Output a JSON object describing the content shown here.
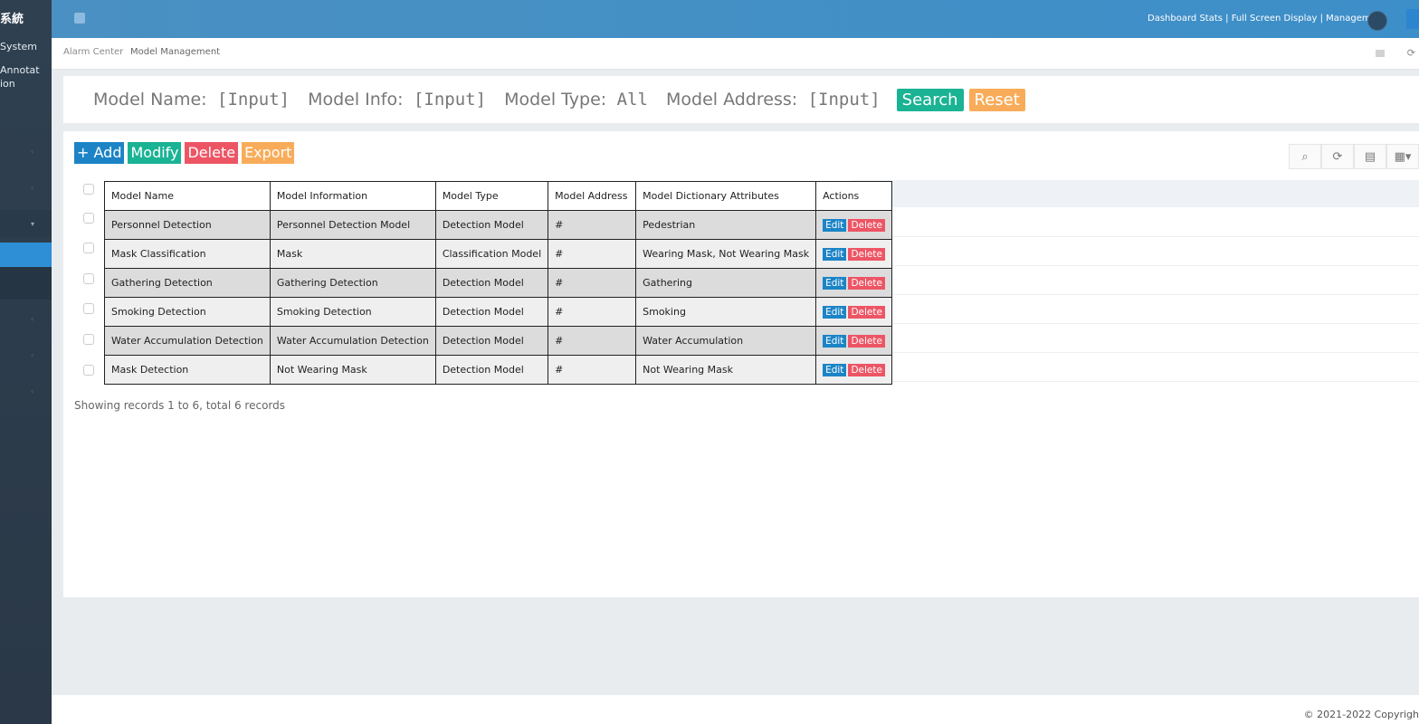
{
  "sidebar": {
    "brand": "系統",
    "items": [
      "System",
      "Annotat ion"
    ]
  },
  "topbar": {
    "links": "Dashboard Stats | Full Screen Display | Management"
  },
  "tabs": {
    "items": [
      "Alarm Center",
      "Model Management"
    ]
  },
  "search": {
    "fields": [
      {
        "label": "Model Name:",
        "value": "[Input]"
      },
      {
        "label": "Model Info:",
        "value": "[Input]"
      },
      {
        "label": "Model Type:",
        "value": "All"
      },
      {
        "label": "Model Address:",
        "value": "[Input]"
      }
    ],
    "search_label": "Search",
    "reset_label": "Reset"
  },
  "toolbar": {
    "add_label": "+ Add",
    "modify_label": "Modify",
    "delete_label": "Delete",
    "export_label": "Export"
  },
  "table": {
    "headers": [
      "Model Name",
      "Model Information",
      "Model Type",
      "Model Address",
      "Model Dictionary Attributes",
      "Actions"
    ],
    "rows": [
      [
        "Personnel Detection",
        "Personnel Detection Model",
        "Detection Model",
        "#",
        "Pedestrian"
      ],
      [
        "Mask Classification",
        "Mask",
        "Classification Model",
        "#",
        "Wearing Mask, Not Wearing Mask"
      ],
      [
        "Gathering Detection",
        "Gathering Detection",
        "Detection Model",
        "#",
        "Gathering"
      ],
      [
        "Smoking Detection",
        "Smoking Detection",
        "Detection Model",
        "#",
        "Smoking"
      ],
      [
        "Water Accumulation Detection",
        "Water Accumulation Detection",
        "Detection Model",
        "#",
        "Water Accumulation"
      ],
      [
        "Mask Detection",
        "Not Wearing Mask",
        "Detection Model",
        "#",
        "Not Wearing Mask"
      ]
    ],
    "edit_label": "Edit",
    "delete_label": "Delete"
  },
  "records_text": "Showing records 1 to 6, total 6 records",
  "footer": {
    "copyright": "© 2021-2022 Copyrigh"
  },
  "colors": {
    "primary": "#1c84c6",
    "success": "#1ab394",
    "danger": "#ed5565",
    "warning": "#f8ac59",
    "sidebar": "#2f4050"
  }
}
